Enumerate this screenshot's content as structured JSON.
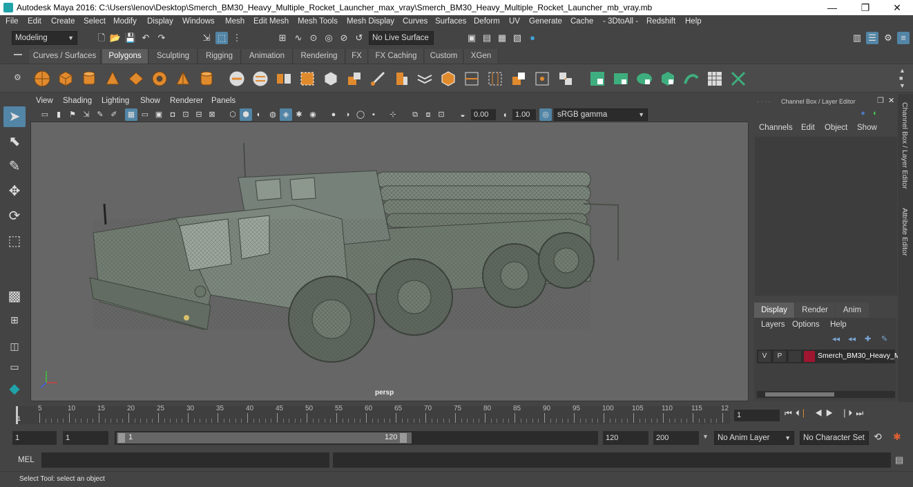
{
  "window": {
    "title": "Autodesk Maya 2016: C:\\Users\\lenov\\Desktop\\Smerch_BM30_Heavy_Multiple_Rocket_Launcher_max_vray\\Smerch_BM30_Heavy_Multiple_Rocket_Launcher_mb_vray.mb",
    "minimize": "—",
    "restore": "❐",
    "close": "✕"
  },
  "menubar": [
    "File",
    "Edit",
    "Create",
    "Select",
    "Modify",
    "Display",
    "Windows",
    "Mesh",
    "Edit Mesh",
    "Mesh Tools",
    "Mesh Display",
    "Curves",
    "Surfaces",
    "Deform",
    "UV",
    "Generate",
    "Cache",
    "- 3DtoAll -",
    "Redshift",
    "Help"
  ],
  "statusline": {
    "mode": "Modeling",
    "live_surface": "No Live Surface"
  },
  "shelf_tabs": [
    "Curves / Surfaces",
    "Polygons",
    "Sculpting",
    "Rigging",
    "Animation",
    "Rendering",
    "FX",
    "FX Caching",
    "Custom",
    "XGen"
  ],
  "shelf_tabs_active": "Polygons",
  "panel": {
    "menu": [
      "View",
      "Shading",
      "Lighting",
      "Show",
      "Renderer",
      "Panels"
    ],
    "exposure": "0.00",
    "gamma": "1.00",
    "color_space": "sRGB gamma",
    "camera_label": "persp"
  },
  "channel_box": {
    "header": "Channel Box / Layer Editor",
    "menu": [
      "Channels",
      "Edit",
      "Object",
      "Show"
    ]
  },
  "layer_editor": {
    "tabs": [
      "Display",
      "Render",
      "Anim"
    ],
    "active_tab": "Display",
    "menu": [
      "Layers",
      "Options",
      "Help"
    ],
    "layers": [
      {
        "visible": "V",
        "playback": "P",
        "color": "#a01530",
        "name": "Smerch_BM30_Heavy_M"
      }
    ]
  },
  "side_tabs": [
    "Channel Box / Layer Editor",
    "Attribute Editor"
  ],
  "time_slider": {
    "ticks": [
      "5",
      "10",
      "15",
      "20",
      "25",
      "30",
      "35",
      "40",
      "45",
      "50",
      "55",
      "60",
      "65",
      "70",
      "75",
      "80",
      "85",
      "90",
      "95",
      "100",
      "105",
      "110",
      "115",
      "12"
    ],
    "start_marker": "1",
    "current_frame": "1"
  },
  "range": {
    "start": "1",
    "anim_start": "1",
    "slider_start": "1",
    "slider_end": "120",
    "end": "120",
    "anim_end": "200",
    "anim_layer": "No Anim Layer",
    "character_set": "No Character Set"
  },
  "command_line": {
    "label": "MEL",
    "help_text": "Select Tool: select an object"
  }
}
